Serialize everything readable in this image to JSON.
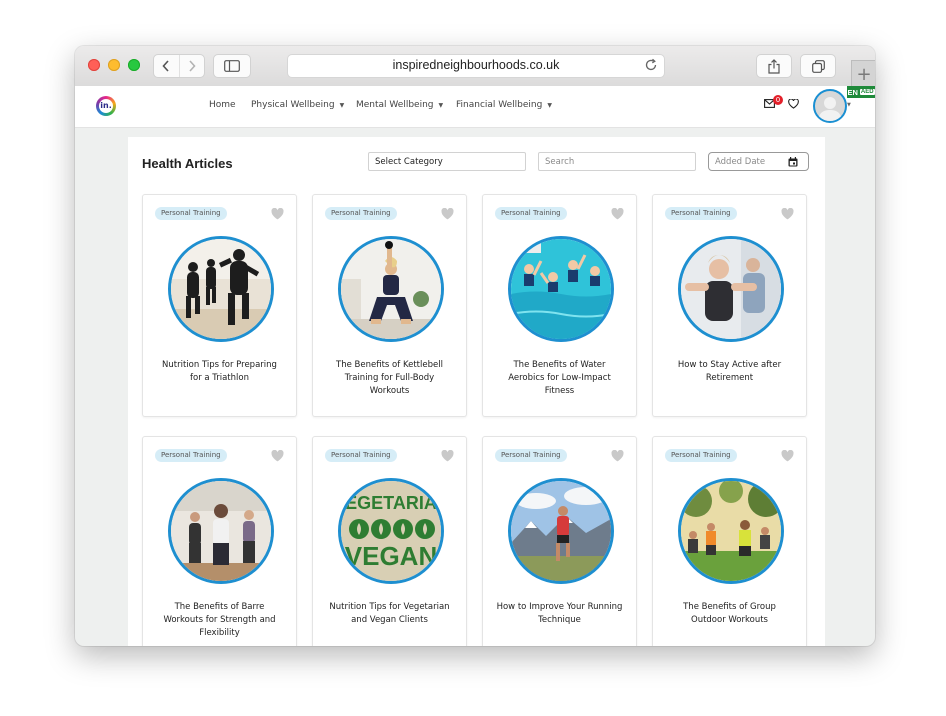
{
  "browser": {
    "url": "inspiredneighbourhoods.co.uk",
    "back_icon": "chevron-left-icon",
    "forward_icon": "chevron-right-icon",
    "new_tab": "+"
  },
  "site": {
    "logo_text": "in.",
    "nav": [
      "Home",
      "Physical Wellbeing",
      "Mental Wellbeing",
      "Financial Wellbeing"
    ],
    "mail_count": "0",
    "language": "EN",
    "language_flag": "AED",
    "accent": "#1e8fd0"
  },
  "page": {
    "title": "Health Articles",
    "category_select": "Select Category",
    "search_placeholder": "Search",
    "date_placeholder": "Added Date"
  },
  "articles": [
    {
      "tag": "Personal Training",
      "title": "Nutrition Tips for Preparing for a Triathlon"
    },
    {
      "tag": "Personal Training",
      "title": "The Benefits of Kettlebell Training for Full-Body Workouts"
    },
    {
      "tag": "Personal Training",
      "title": "The Benefits of Water Aerobics for Low-Impact Fitness"
    },
    {
      "tag": "Personal Training",
      "title": "How to Stay Active after Retirement"
    },
    {
      "tag": "Personal Training",
      "title": "The Benefits of Barre Workouts for Strength and Flexibility"
    },
    {
      "tag": "Personal Training",
      "title": "Nutrition Tips for Vegetarian and Vegan Clients",
      "thumb_text_top": "EGETARIA",
      "thumb_text_bottom": "VEGAN"
    },
    {
      "tag": "Personal Training",
      "title": "How to Improve Your Running Technique"
    },
    {
      "tag": "Personal Training",
      "title": "The Benefits of Group Outdoor Workouts"
    }
  ]
}
